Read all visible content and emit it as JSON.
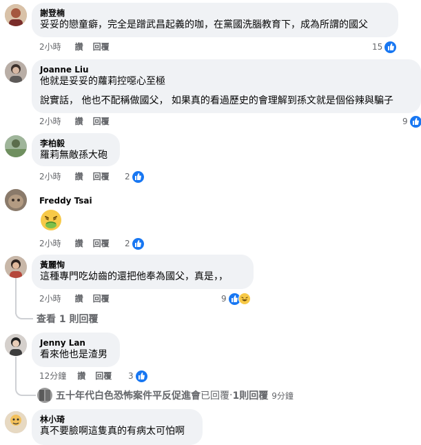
{
  "comments": [
    {
      "name": "謝登楠",
      "texts": [
        "妥妥的戀童癖，完全是蹭武昌起義的咖，在黨國洗腦教育下，成為所謂的國父"
      ],
      "time": "2小時",
      "like": "讚",
      "reply": "回覆",
      "reactions": "15"
    },
    {
      "name": "Joanne Liu",
      "texts": [
        "他就是妥妥的蘿莉控噁心至極",
        "說實話， 他也不配稱做國父， 如果真的看過歷史的會理解到孫文就是個俗辣與騙子"
      ],
      "time": "2小時",
      "like": "讚",
      "reply": "回覆",
      "reactions": "9"
    },
    {
      "name": "李柏毅",
      "texts": [
        "羅莉無敵孫大砲"
      ],
      "time": "2小時",
      "like": "讚",
      "reply": "回覆",
      "reactions": "2"
    },
    {
      "name": "Freddy Tsai",
      "texts": [],
      "emoji": "nauseated-face",
      "time": "2小時",
      "like": "讚",
      "reply": "回覆",
      "reactions": "2"
    },
    {
      "name": "黃麗恂",
      "texts": [
        "這種專門吃幼齒的還把他奉為國父，真是，，"
      ],
      "time": "2小時",
      "like": "讚",
      "reply": "回覆",
      "reactions": "9",
      "view_replies": "查看 1 則回覆"
    },
    {
      "name": "Jenny Lan",
      "texts": [
        "看來他也是渣男"
      ],
      "time": "12分鐘",
      "like": "讚",
      "reply": "回覆",
      "reactions": "3",
      "reply_summary": {
        "author": "五十年代白色恐怖案件平反促進會",
        "verb": "已回覆",
        "sep": " · ",
        "count": "1則回覆",
        "time": "9分鐘"
      }
    },
    {
      "name": "林小琦",
      "texts": [
        "真不要臉啊這隻真的有病太可怕啊"
      ]
    }
  ],
  "colors": {
    "bubble": "#f0f2f5",
    "meta": "#65676b",
    "like_blue": "#1877f2",
    "haha_yellow": "#f7c948"
  }
}
